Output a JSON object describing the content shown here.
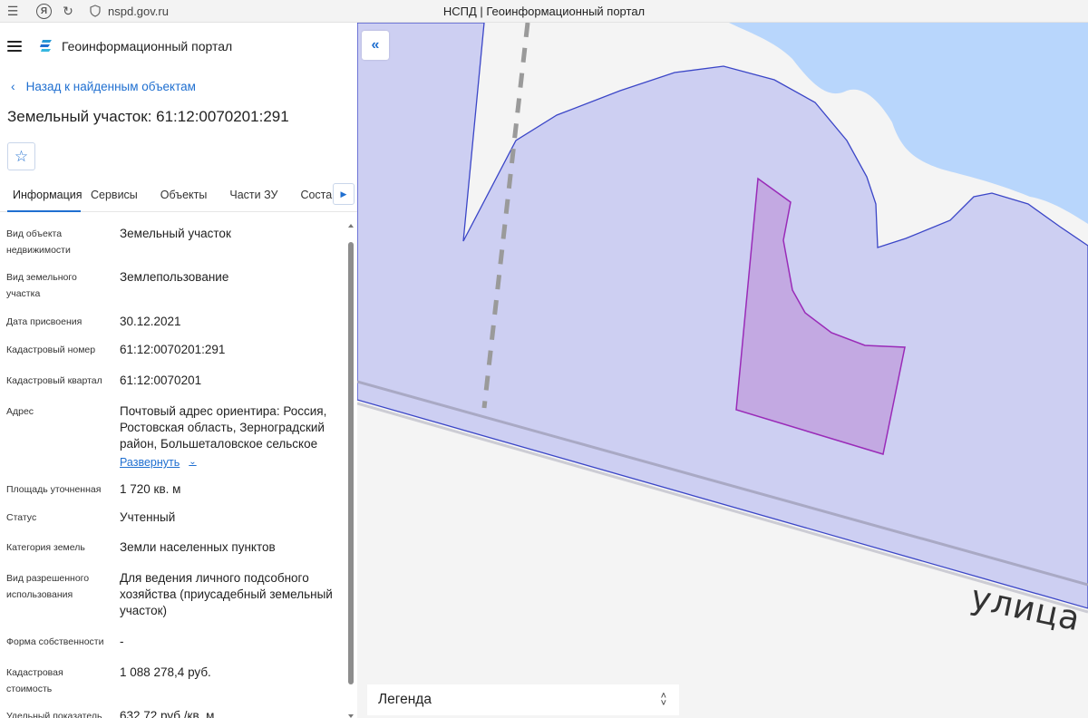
{
  "browser": {
    "url": "nspd.gov.ru",
    "tab_title": "НСПД | Геоинформационный портал",
    "icons": [
      "hamburger-icon",
      "yandex-icon",
      "reload-icon",
      "shield-icon"
    ]
  },
  "header": {
    "portal_name": "Геоинформационный портал"
  },
  "nav": {
    "back_label": "Назад к найденным объектам"
  },
  "object": {
    "title": "Земельный участок: 61:12:0070201:291"
  },
  "tabs": [
    {
      "label": "Информация",
      "active": true
    },
    {
      "label": "Сервисы"
    },
    {
      "label": "Объекты"
    },
    {
      "label": "Части ЗУ"
    },
    {
      "label": "Состав"
    }
  ],
  "properties": [
    {
      "label": "Вид объекта недвижимости",
      "value": "Земельный участок"
    },
    {
      "label": "Вид земельного участка",
      "value": "Землепользование"
    },
    {
      "label": "Дата присвоения",
      "value": "30.12.2021"
    },
    {
      "label": "Кадастровый номер",
      "value": "61:12:0070201:291"
    },
    {
      "label": "Кадастровый квартал",
      "value": "61:12:0070201"
    },
    {
      "label": "Адрес",
      "value": "Почтовый адрес ориентира: Россия, Ростовская область, Зерноградский район, Большеталовское сельское",
      "expand_label": "Развернуть"
    },
    {
      "label": "Площадь уточненная",
      "value": "1 720 кв. м"
    },
    {
      "label": "Статус",
      "value": "Учтенный"
    },
    {
      "label": "Категория земель",
      "value": "Земли населенных пунктов"
    },
    {
      "label": "Вид разрешенного использования",
      "value": "Для ведения личного подсобного хозяйства (приусадебный земельный участок)"
    },
    {
      "label": "Форма собственности",
      "value": "-"
    },
    {
      "label": "Кадастровая стоимость",
      "value": "1 088 278,4 руб."
    },
    {
      "label": "Удельный показатель",
      "value": "632,72 руб./кв. м"
    }
  ],
  "map": {
    "street_label": "улица",
    "legend_label": "Легенда",
    "colors": {
      "water": "#b8d6fc",
      "land": "#f4f4f4",
      "quarter_fill": "#c6c8f1",
      "quarter_stroke": "#3b46c7",
      "parcel_fill": "#c3a9e2",
      "parcel_stroke": "#9a2bb8"
    }
  }
}
